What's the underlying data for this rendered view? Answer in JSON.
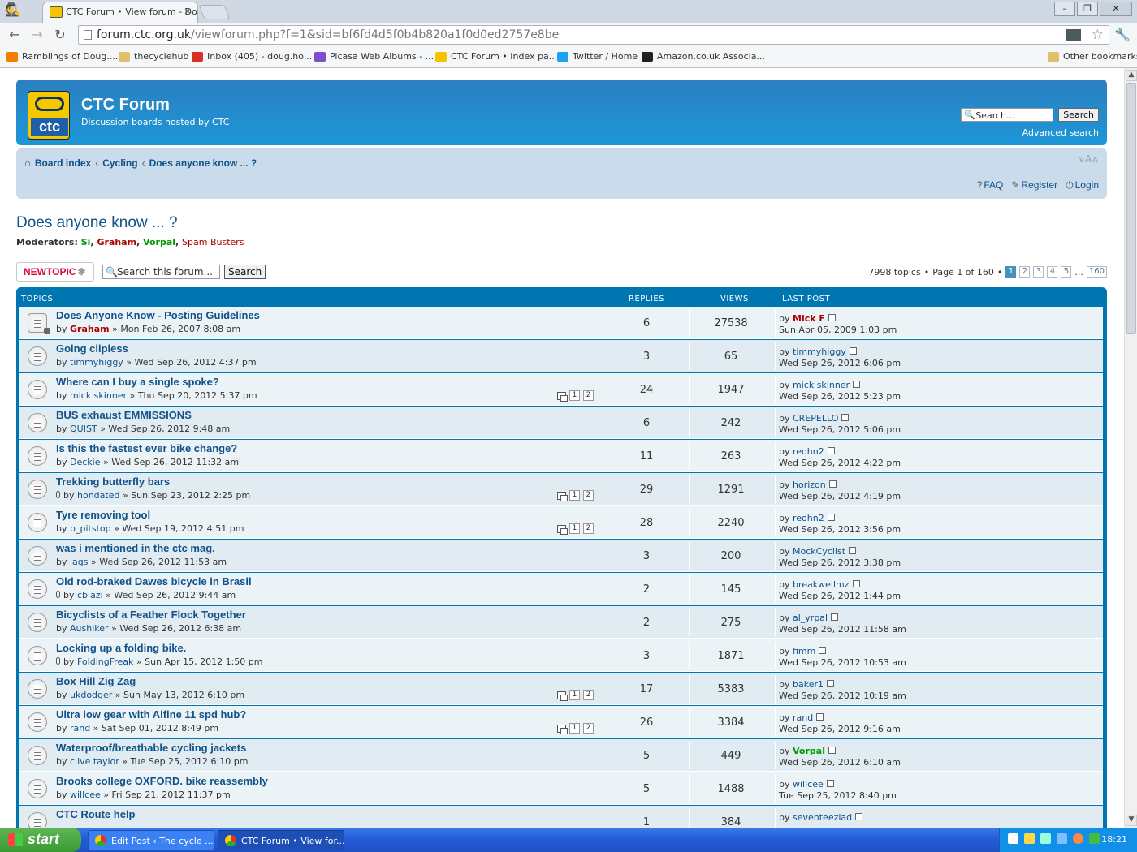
{
  "browser": {
    "tab_title": "CTC Forum • View forum - Do",
    "url_host": "forum.ctc.org.uk",
    "url_path": "/viewforum.php?f=1&sid=bf6fd4d5f0b4b820a1f0d0ed2757e8be",
    "bookmarks": [
      {
        "label": "Ramblings of Doug....",
        "icon": "blogger-icon",
        "color": "#f57d00"
      },
      {
        "label": "thecyclehub",
        "icon": "folder-icon",
        "color": "#e0c068"
      },
      {
        "label": "Inbox (405) - doug.ho...",
        "icon": "gmail-icon",
        "color": "#d93025"
      },
      {
        "label": "Picasa Web Albums - ...",
        "icon": "picasa-icon",
        "color": "#7b4fc9"
      },
      {
        "label": "CTC Forum • Index pa...",
        "icon": "ctc-icon",
        "color": "#f3c400"
      },
      {
        "label": "Twitter / Home",
        "icon": "twitter-icon",
        "color": "#1da1f2"
      },
      {
        "label": "Amazon.co.uk Associa...",
        "icon": "amazon-icon",
        "color": "#222222"
      }
    ],
    "other_bookmarks": "Other bookmarks"
  },
  "header": {
    "site_name": "CTC Forum",
    "site_desc": "Discussion boards hosted by CTC",
    "logo_text": "ctc",
    "search_placeholder": "Search...",
    "search_button": "Search",
    "advanced_search": "Advanced search"
  },
  "navbar": {
    "crumbs": [
      "Board index",
      "Cycling",
      "Does anyone know ... ?"
    ],
    "sep": "‹",
    "faq": "FAQ",
    "register": "Register",
    "login": "Login",
    "font_toggle": "∨A∧"
  },
  "forum": {
    "title": "Does anyone know ... ?",
    "moderators_label": "Moderators:",
    "moderators": [
      "Si",
      "Graham",
      "Vorpal",
      "Spam Busters"
    ],
    "new_topic": "NEWTOPIC",
    "search_placeholder": "Search this forum...",
    "search_button": "Search",
    "topic_count": "7998 topics",
    "page_info": "Page 1 of 160",
    "pages": [
      "1",
      "2",
      "3",
      "4",
      "5"
    ],
    "ellipsis": "...",
    "last_page": "160"
  },
  "columns": {
    "topics": "TOPICS",
    "replies": "REPLIES",
    "views": "VIEWS",
    "last_post": "LAST POST"
  },
  "topics": [
    {
      "title": "Does Anyone Know - Posting Guidelines",
      "author": "Graham",
      "author_style": "r",
      "date": "Mon Feb 26, 2007 8:08 am",
      "replies": "6",
      "views": "27538",
      "last_by": "Mick F",
      "last_style": "r",
      "last_date": "Sun Apr 05, 2009 1:03 pm",
      "pages": [],
      "attach": false,
      "locked": true
    },
    {
      "title": "Going clipless",
      "author": "timmyhiggy",
      "author_style": "",
      "date": "Wed Sep 26, 2012 4:37 pm",
      "replies": "3",
      "views": "65",
      "last_by": "timmyhiggy",
      "last_style": "",
      "last_date": "Wed Sep 26, 2012 6:06 pm",
      "pages": [],
      "attach": false,
      "locked": false
    },
    {
      "title": "Where can I buy a single spoke?",
      "author": "mick skinner",
      "author_style": "",
      "date": "Thu Sep 20, 2012 5:37 pm",
      "replies": "24",
      "views": "1947",
      "last_by": "mick skinner",
      "last_style": "",
      "last_date": "Wed Sep 26, 2012 5:23 pm",
      "pages": [
        "1",
        "2"
      ],
      "attach": false,
      "locked": false
    },
    {
      "title": "BUS exhaust EMMISSIONS",
      "author": "QUIST",
      "author_style": "",
      "date": "Wed Sep 26, 2012 9:48 am",
      "replies": "6",
      "views": "242",
      "last_by": "CREPELLO",
      "last_style": "",
      "last_date": "Wed Sep 26, 2012 5:06 pm",
      "pages": [],
      "attach": false,
      "locked": false
    },
    {
      "title": "Is this the fastest ever bike change?",
      "author": "Deckie",
      "author_style": "",
      "date": "Wed Sep 26, 2012 11:32 am",
      "replies": "11",
      "views": "263",
      "last_by": "reohn2",
      "last_style": "",
      "last_date": "Wed Sep 26, 2012 4:22 pm",
      "pages": [],
      "attach": false,
      "locked": false
    },
    {
      "title": "Trekking butterfly bars",
      "author": "hondated",
      "author_style": "",
      "date": "Sun Sep 23, 2012 2:25 pm",
      "replies": "29",
      "views": "1291",
      "last_by": "horizon",
      "last_style": "",
      "last_date": "Wed Sep 26, 2012 4:19 pm",
      "pages": [
        "1",
        "2"
      ],
      "attach": true,
      "locked": false
    },
    {
      "title": "Tyre removing tool",
      "author": "p_pitstop",
      "author_style": "",
      "date": "Wed Sep 19, 2012 4:51 pm",
      "replies": "28",
      "views": "2240",
      "last_by": "reohn2",
      "last_style": "",
      "last_date": "Wed Sep 26, 2012 3:56 pm",
      "pages": [
        "1",
        "2"
      ],
      "attach": false,
      "locked": false
    },
    {
      "title": "was i mentioned in the ctc mag.",
      "author": "jags",
      "author_style": "",
      "date": "Wed Sep 26, 2012 11:53 am",
      "replies": "3",
      "views": "200",
      "last_by": "MockCyclist",
      "last_style": "",
      "last_date": "Wed Sep 26, 2012 3:38 pm",
      "pages": [],
      "attach": false,
      "locked": false
    },
    {
      "title": "Old rod-braked Dawes bicycle in Brasil",
      "author": "cbiazi",
      "author_style": "",
      "date": "Wed Sep 26, 2012 9:44 am",
      "replies": "2",
      "views": "145",
      "last_by": "breakwellmz",
      "last_style": "",
      "last_date": "Wed Sep 26, 2012 1:44 pm",
      "pages": [],
      "attach": true,
      "locked": false
    },
    {
      "title": "Bicyclists of a Feather Flock Together",
      "author": "Aushiker",
      "author_style": "",
      "date": "Wed Sep 26, 2012 6:38 am",
      "replies": "2",
      "views": "275",
      "last_by": "al_yrpal",
      "last_style": "",
      "last_date": "Wed Sep 26, 2012 11:58 am",
      "pages": [],
      "attach": false,
      "locked": false
    },
    {
      "title": "Locking up a folding bike.",
      "author": "FoldingFreak",
      "author_style": "",
      "date": "Sun Apr 15, 2012 1:50 pm",
      "replies": "3",
      "views": "1871",
      "last_by": "fimm",
      "last_style": "",
      "last_date": "Wed Sep 26, 2012 10:53 am",
      "pages": [],
      "attach": true,
      "locked": false
    },
    {
      "title": "Box Hill Zig Zag",
      "author": "ukdodger",
      "author_style": "",
      "date": "Sun May 13, 2012 6:10 pm",
      "replies": "17",
      "views": "5383",
      "last_by": "baker1",
      "last_style": "",
      "last_date": "Wed Sep 26, 2012 10:19 am",
      "pages": [
        "1",
        "2"
      ],
      "attach": false,
      "locked": false
    },
    {
      "title": "Ultra low gear with Alfine 11 spd hub?",
      "author": "rand",
      "author_style": "",
      "date": "Sat Sep 01, 2012 8:49 pm",
      "replies": "26",
      "views": "3384",
      "last_by": "rand",
      "last_style": "",
      "last_date": "Wed Sep 26, 2012 9:16 am",
      "pages": [
        "1",
        "2"
      ],
      "attach": false,
      "locked": false
    },
    {
      "title": "Waterproof/breathable cycling jackets",
      "author": "clive taylor",
      "author_style": "",
      "date": "Tue Sep 25, 2012 6:10 pm",
      "replies": "5",
      "views": "449",
      "last_by": "Vorpal",
      "last_style": "g",
      "last_date": "Wed Sep 26, 2012 6:10 am",
      "pages": [],
      "attach": false,
      "locked": false
    },
    {
      "title": "Brooks college OXFORD. bike reassembly",
      "author": "willcee",
      "author_style": "",
      "date": "Fri Sep 21, 2012 11:37 pm",
      "replies": "5",
      "views": "1488",
      "last_by": "willcee",
      "last_style": "",
      "last_date": "Tue Sep 25, 2012 8:40 pm",
      "pages": [],
      "attach": false,
      "locked": false
    },
    {
      "title": "CTC Route help",
      "author": "",
      "author_style": "",
      "date": "",
      "replies": "1",
      "views": "384",
      "last_by": "seventeezlad",
      "last_style": "",
      "last_date": "",
      "pages": [],
      "attach": false,
      "locked": false
    }
  ],
  "taskbar": {
    "start": "start",
    "tasks": [
      "Edit Post ‹ The cycle ...",
      "CTC Forum • View for..."
    ],
    "clock": "18:21"
  }
}
